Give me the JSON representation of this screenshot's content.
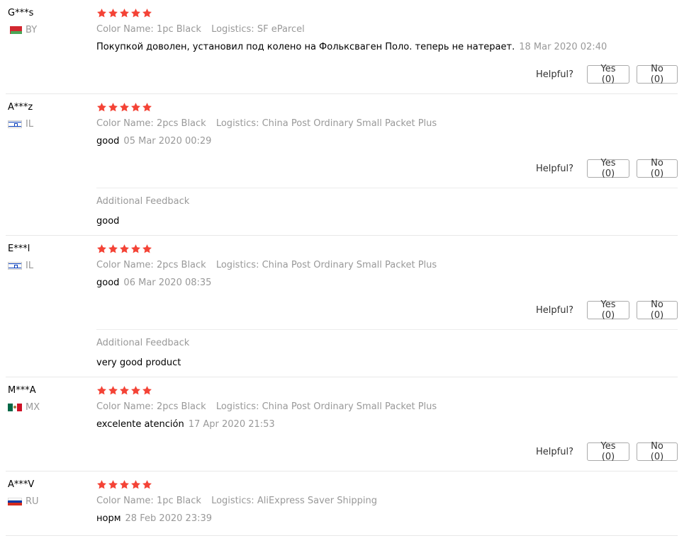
{
  "colors": {
    "star": "#f44336",
    "muted": "#999999",
    "border": "#e8e8e8"
  },
  "labels": {
    "color_name": "Color Name:",
    "logistics": "Logistics:",
    "helpful": "Helpful?",
    "additional_feedback": "Additional Feedback"
  },
  "reviews": [
    {
      "user": "G***s",
      "country": "BY",
      "flag": "by",
      "rating": 5,
      "color_name": "1pc Black",
      "logistics": "SF eParcel",
      "text": "Покупкой доволен, установил под колено на Фольксваген Поло. теперь не натерает.",
      "date": "18 Mar 2020 02:40",
      "yes": "Yes (0)",
      "no": "No (0)"
    },
    {
      "user": "A***z",
      "country": "IL",
      "flag": "il",
      "rating": 5,
      "color_name": "2pcs Black",
      "logistics": "China Post Ordinary Small Packet Plus",
      "text": "good",
      "date": "05 Mar 2020 00:29",
      "yes": "Yes (0)",
      "no": "No (0)",
      "additional": "good"
    },
    {
      "user": "E***l",
      "country": "IL",
      "flag": "il",
      "rating": 5,
      "color_name": "2pcs Black",
      "logistics": "China Post Ordinary Small Packet Plus",
      "text": "good",
      "date": "06 Mar 2020 08:35",
      "yes": "Yes (0)",
      "no": "No (0)",
      "additional": "very good product"
    },
    {
      "user": "M***A",
      "country": "MX",
      "flag": "mx",
      "rating": 5,
      "color_name": "2pcs Black",
      "logistics": "China Post Ordinary Small Packet Plus",
      "text": "excelente atención",
      "date": "17 Apr 2020 21:53",
      "yes": "Yes (0)",
      "no": "No (0)"
    },
    {
      "user": "A***V",
      "country": "RU",
      "flag": "ru",
      "rating": 5,
      "color_name": "1pc Black",
      "logistics": "AliExpress Saver Shipping",
      "text": "норм",
      "date": "28 Feb 2020 23:39",
      "yes": "Yes (0)",
      "no": "No (0)"
    }
  ]
}
